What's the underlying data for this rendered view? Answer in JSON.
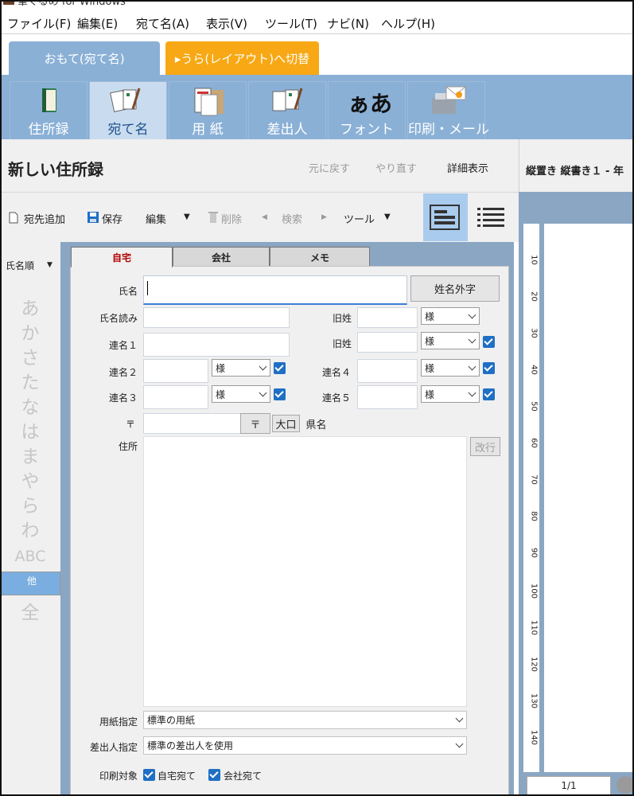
{
  "window": {
    "title": "筆ぐるめ for Windows"
  },
  "menu": [
    "ファイル(F)",
    "編集(E)",
    "宛て名(A)",
    "表示(V)",
    "ツール(T)",
    "ナビ(N)",
    "ヘルプ(H)"
  ],
  "top_tabs": {
    "front": "おもて(宛て名)",
    "back": "▸うら(レイアウト)へ切替"
  },
  "ribbon": [
    "住所録",
    "宛て名",
    "用 紙",
    "差出人",
    "フォント",
    "印刷・メール"
  ],
  "ribbon_font_glyph": "ぁあ",
  "address_book": {
    "title": "新しい住所録",
    "undo": "元に戻す",
    "redo": "やり直す",
    "detail": "詳細表示"
  },
  "toolbar": {
    "add": "宛先追加",
    "save": "保存",
    "edit": "編集",
    "delete": "削除",
    "search": "検索",
    "tools": "ツール"
  },
  "sidebar": {
    "sort": "氏名順",
    "index": [
      "あ",
      "か",
      "さ",
      "た",
      "な",
      "は",
      "ま",
      "や",
      "ら",
      "わ",
      "ABC",
      "他",
      "全"
    ],
    "selected": "他"
  },
  "form": {
    "tabs": [
      "自宅",
      "会社",
      "メモ"
    ],
    "name_label": "氏名",
    "name_button": "姓名外字",
    "reading_label": "氏名読み",
    "old_name_label": "旧姓",
    "old_name_label2": "旧姓",
    "joint1_label": "連名１",
    "joint2_label": "連名２",
    "joint3_label": "連名３",
    "joint4_label": "連名４",
    "joint5_label": "連名５",
    "honorific": "様",
    "zip_label": "〒",
    "zip_button": "〒",
    "bigcode_button": "大口",
    "pref_button": "県名",
    "address_label": "住所",
    "newline_button": "改行",
    "paper_label": "用紙指定",
    "paper_value": "標準の用紙",
    "sender_label": "差出人指定",
    "sender_value": "標準の差出人を使用",
    "print_label": "印刷対象",
    "print_home": "自宅宛て",
    "print_company": "会社宛て"
  },
  "preview": {
    "title": "縦置き 縦書き１ - 年",
    "ruler": [
      "10",
      "20",
      "30",
      "40",
      "50",
      "60",
      "70",
      "80",
      "90",
      "100",
      "110",
      "120",
      "130",
      "140"
    ],
    "page": "1/1"
  },
  "colors": {
    "ribbon": "#8ab0d6",
    "switch_tab": "#f7a814",
    "accent": "#1f6fc4"
  }
}
